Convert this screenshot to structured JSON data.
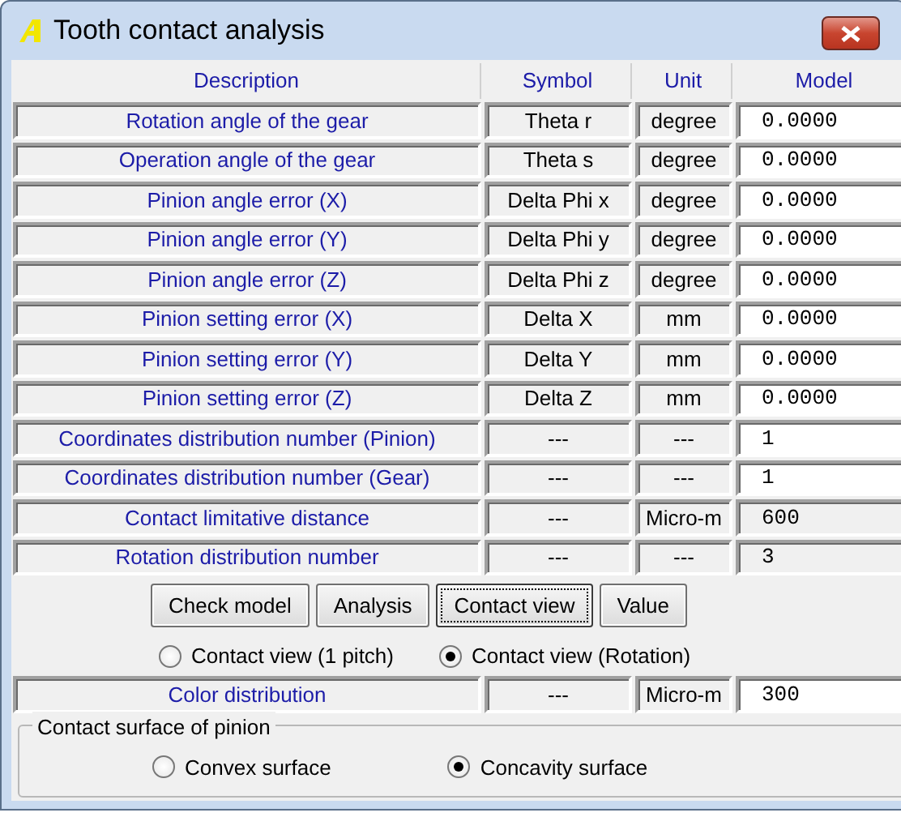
{
  "window": {
    "title": "Tooth contact analysis"
  },
  "table": {
    "columns": [
      "Description",
      "Symbol",
      "Unit",
      "Model"
    ],
    "rows": [
      {
        "description": "Rotation angle of the gear",
        "symbol": "Theta r",
        "unit": "degree",
        "model": "0.0000",
        "readonly": false
      },
      {
        "description": "Operation angle of the gear",
        "symbol": "Theta s",
        "unit": "degree",
        "model": "0.0000",
        "readonly": false
      },
      {
        "description": "Pinion angle error (X)",
        "symbol": "Delta Phi x",
        "unit": "degree",
        "model": "0.0000",
        "readonly": false
      },
      {
        "description": "Pinion angle error (Y)",
        "symbol": "Delta Phi y",
        "unit": "degree",
        "model": "0.0000",
        "readonly": false
      },
      {
        "description": "Pinion angle error (Z)",
        "symbol": "Delta Phi z",
        "unit": "degree",
        "model": "0.0000",
        "readonly": false
      },
      {
        "description": "Pinion setting error (X)",
        "symbol": "Delta X",
        "unit": "mm",
        "model": "0.0000",
        "readonly": false
      },
      {
        "description": "Pinion setting error (Y)",
        "symbol": "Delta Y",
        "unit": "mm",
        "model": "0.0000",
        "readonly": false
      },
      {
        "description": "Pinion setting error (Z)",
        "symbol": "Delta Z",
        "unit": "mm",
        "model": "0.0000",
        "readonly": false
      },
      {
        "description": "Coordinates distribution number (Pinion)",
        "symbol": "---",
        "unit": "---",
        "model": "1",
        "readonly": false
      },
      {
        "description": "Coordinates distribution number (Gear)",
        "symbol": "---",
        "unit": "---",
        "model": "1",
        "readonly": false
      },
      {
        "description": "Contact limitative distance",
        "symbol": "---",
        "unit": "Micro-m",
        "model": "600",
        "readonly": true
      },
      {
        "description": "Rotation distribution number",
        "symbol": "---",
        "unit": "---",
        "model": "3",
        "readonly": true
      }
    ]
  },
  "buttons": [
    {
      "label": "Check model",
      "focused": false
    },
    {
      "label": "Analysis",
      "focused": false
    },
    {
      "label": "Contact view",
      "focused": true
    },
    {
      "label": "Value",
      "focused": false
    }
  ],
  "view_options": [
    {
      "label": "Contact view (1 pitch)",
      "selected": false
    },
    {
      "label": "Contact view (Rotation)",
      "selected": true
    }
  ],
  "color_row": {
    "description": "Color distribution",
    "symbol": "---",
    "unit": "Micro-m",
    "model": "300",
    "readonly": false
  },
  "surface_group": {
    "title": "Contact surface of pinion",
    "options": [
      {
        "label": "Convex surface",
        "selected": false
      },
      {
        "label": "Concavity surface",
        "selected": true
      }
    ]
  }
}
